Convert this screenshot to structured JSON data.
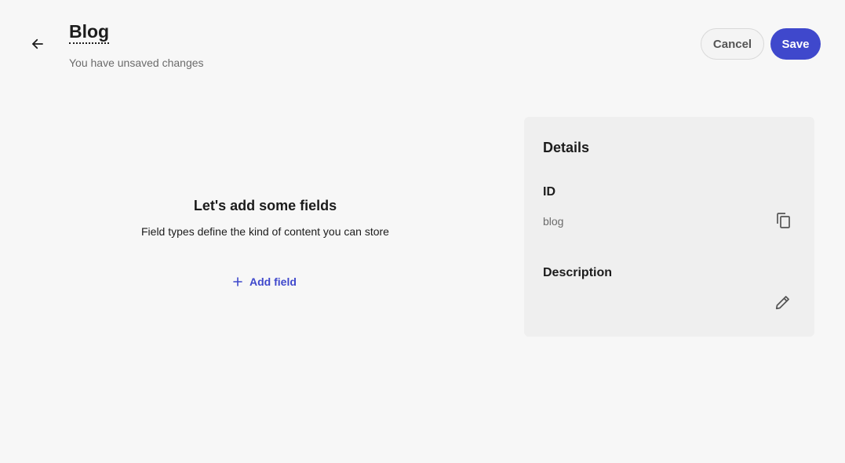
{
  "header": {
    "back_icon": "arrow-left-icon",
    "title": "Blog",
    "status": "You have unsaved changes",
    "cancel_label": "Cancel",
    "save_label": "Save"
  },
  "empty_state": {
    "heading": "Let's add some fields",
    "subtext": "Field types define the kind of content you can store",
    "add_icon": "plus-icon",
    "add_label": "Add field"
  },
  "details": {
    "title": "Details",
    "id_label": "ID",
    "id_value": "blog",
    "copy_icon": "copy-icon",
    "description_label": "Description",
    "edit_icon": "pencil-icon"
  },
  "colors": {
    "accent": "#3f48cc",
    "background": "#f7f7f7",
    "panel": "#efefef",
    "muted_text": "#6b6b6b"
  }
}
